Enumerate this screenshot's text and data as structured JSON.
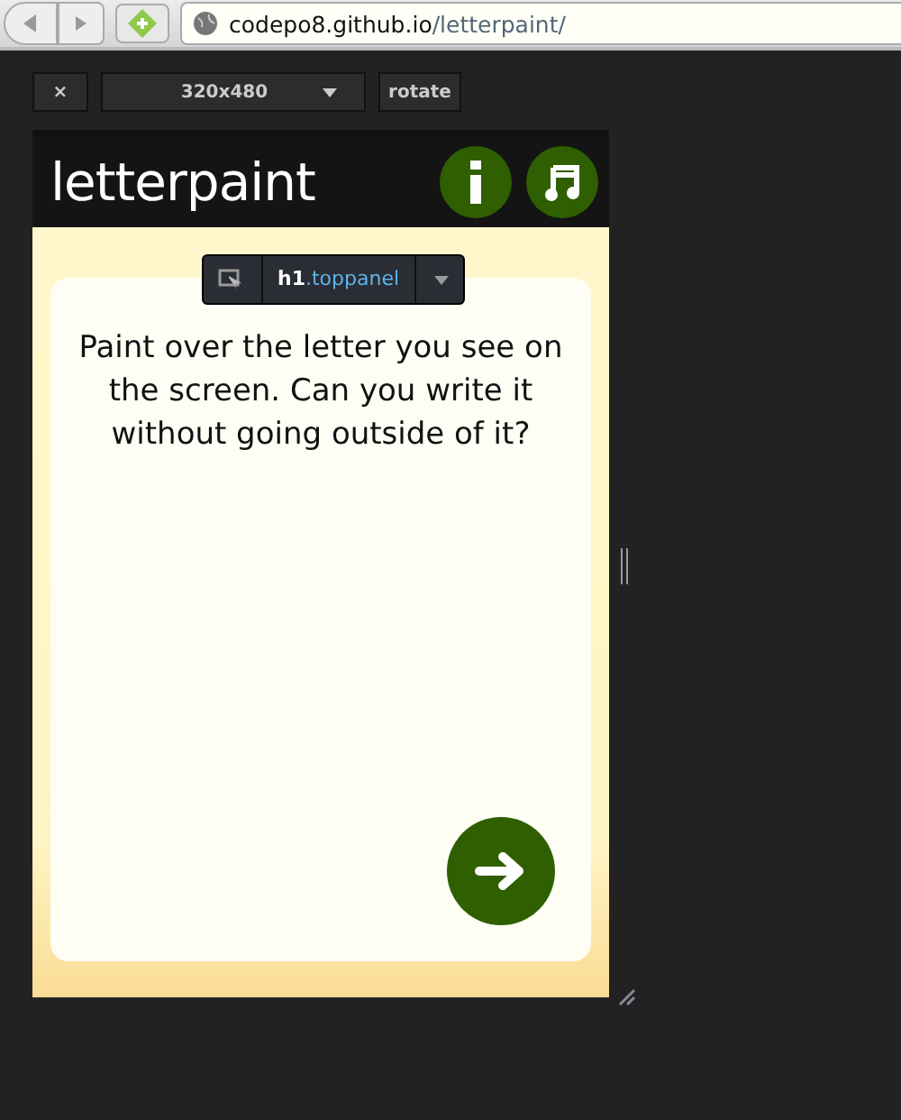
{
  "browser": {
    "back_disabled": true,
    "forward_disabled": true,
    "url": {
      "host": "codepo8.github.io",
      "path": "/letterpaint/"
    }
  },
  "toolbar": {
    "close": "×",
    "size": "320x480",
    "rotate": "rotate"
  },
  "app": {
    "title": "letterpaint",
    "prompt": "Paint over the letter you see on the screen. Can you write it without going outside of it?"
  },
  "inspector": {
    "tag": "h1",
    "class": ".toppanel"
  }
}
